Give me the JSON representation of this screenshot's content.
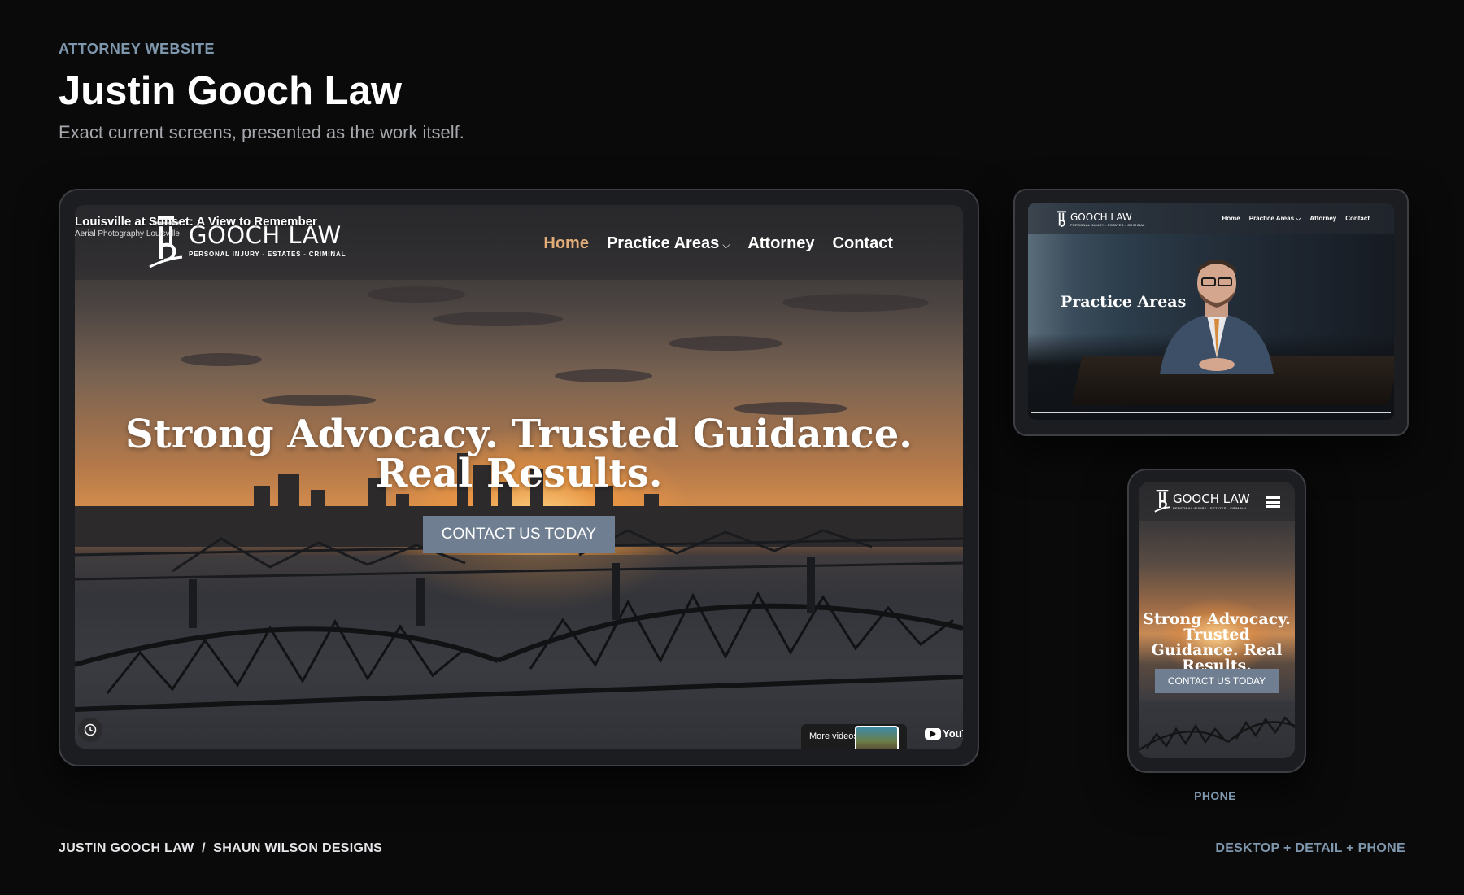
{
  "header": {
    "eyebrow": "ATTORNEY WEBSITE",
    "title": "Justin Gooch Law",
    "subtitle": "Exact current screens, presented as the work itself."
  },
  "desktop": {
    "video_title": "Louisville at Sunset: A View to Remember",
    "video_subtitle": "Aerial Photography Louisville",
    "logo_name": "GOOCH LAW",
    "logo_tagline": "PERSONAL INJURY - ESTATES - CRIMINAL",
    "nav": [
      {
        "label": "Home",
        "active": true
      },
      {
        "label": "Practice Areas",
        "dropdown": true
      },
      {
        "label": "Attorney"
      },
      {
        "label": "Contact"
      }
    ],
    "hero_heading": "Strong Advocacy. Trusted Guidance. Real Results.",
    "cta_label": "CONTACT US TODAY",
    "more_videos_label": "More videos",
    "youtube_label": "YouT"
  },
  "detail": {
    "logo_name": "GOOCH LAW",
    "logo_tagline": "PERSONAL INJURY - ESTATES - CRIMINAL",
    "nav": [
      {
        "label": "Home"
      },
      {
        "label": "Practice Areas",
        "active": true,
        "dropdown": true
      },
      {
        "label": "Attorney"
      },
      {
        "label": "Contact"
      }
    ],
    "heading": "Practice Areas"
  },
  "phone": {
    "logo_name": "GOOCH LAW",
    "logo_tagline": "PERSONAL INJURY - ESTATES - CRIMINAL",
    "hero_heading": "Strong Advocacy. Trusted Guidance. Real Results.",
    "cta_label": "CONTACT US TODAY",
    "label": "PHONE"
  },
  "footer": {
    "left": "JUSTIN GOOCH LAW  /  SHAUN WILSON DESIGNS",
    "right": "DESKTOP + DETAIL + PHONE"
  },
  "colors": {
    "background": "#0a0a0b",
    "accent_label": "#7f97ad",
    "nav_active": "#e2ac78",
    "cta": "#6f7f91"
  }
}
